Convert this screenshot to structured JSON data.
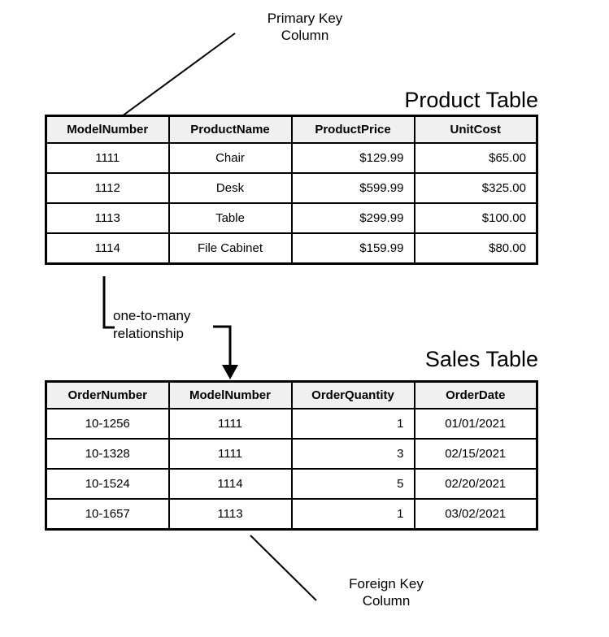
{
  "annotations": {
    "primary_key": "Primary Key\nColumn",
    "foreign_key": "Foreign Key\nColumn",
    "relationship": "one-to-many\nrelationship"
  },
  "product_table": {
    "title": "Product Table",
    "columns": [
      "ModelNumber",
      "ProductName",
      "ProductPrice",
      "UnitCost"
    ],
    "rows": [
      {
        "ModelNumber": "1111",
        "ProductName": "Chair",
        "ProductPrice": "$129.99",
        "UnitCost": "$65.00"
      },
      {
        "ModelNumber": "1112",
        "ProductName": "Desk",
        "ProductPrice": "$599.99",
        "UnitCost": "$325.00"
      },
      {
        "ModelNumber": "1113",
        "ProductName": "Table",
        "ProductPrice": "$299.99",
        "UnitCost": "$100.00"
      },
      {
        "ModelNumber": "1114",
        "ProductName": "File Cabinet",
        "ProductPrice": "$159.99",
        "UnitCost": "$80.00"
      }
    ]
  },
  "sales_table": {
    "title": "Sales Table",
    "columns": [
      "OrderNumber",
      "ModelNumber",
      "OrderQuantity",
      "OrderDate"
    ],
    "rows": [
      {
        "OrderNumber": "10-1256",
        "ModelNumber": "1111",
        "OrderQuantity": "1",
        "OrderDate": "01/01/2021"
      },
      {
        "OrderNumber": "10-1328",
        "ModelNumber": "1111",
        "OrderQuantity": "3",
        "OrderDate": "02/15/2021"
      },
      {
        "OrderNumber": "10-1524",
        "ModelNumber": "1114",
        "OrderQuantity": "5",
        "OrderDate": "02/20/2021"
      },
      {
        "OrderNumber": "10-1657",
        "ModelNumber": "1113",
        "OrderQuantity": "1",
        "OrderDate": "03/02/2021"
      }
    ]
  },
  "colors": {
    "header_fill": "#f0f0f0",
    "line": "#000000",
    "background": "#ffffff"
  }
}
